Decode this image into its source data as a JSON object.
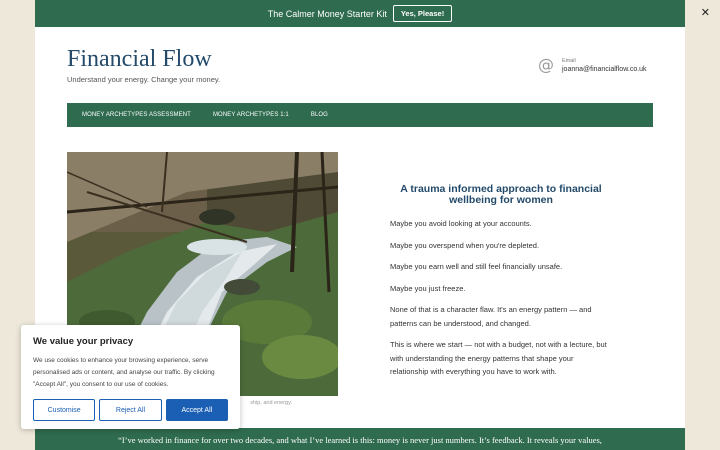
{
  "topbar": {
    "promo": "The Calmer Money Starter Kit",
    "cta": "Yes, Please!",
    "close": "✕"
  },
  "brand": {
    "title": "Financial Flow",
    "tagline": "Understand your energy. Change your money."
  },
  "contact": {
    "icon": "at-sign-icon",
    "label": "Email",
    "email": "joanna@financialflow.co.uk"
  },
  "nav": {
    "items": [
      "MONEY ARCHETYPES ASSESSMENT",
      "MONEY ARCHETYPES 1:1",
      "BLOG"
    ]
  },
  "hero": {
    "image": "stream-photo",
    "caption": "ship, and energy."
  },
  "content": {
    "heading": "A trauma informed approach to financial wellbeing for women",
    "paragraphs": [
      "Maybe you avoid looking at your accounts.",
      "Maybe you overspend when you're depleted.",
      "Maybe you earn well and still feel financially unsafe.",
      "Maybe you just freeze.",
      "None of that is a character flaw. It's an energy pattern — and patterns can be understood, and changed.",
      "This is where we start — not with a budget, not with a lecture, but with understanding the energy patterns that shape your relationship with everything you have to work with."
    ]
  },
  "quote": "“I’ve worked in finance for over two decades, and what I’ve learned is this: money is never just numbers. It’s feedback. It reveals your values,",
  "cookie": {
    "title": "We value your privacy",
    "text": "We use cookies to enhance your browsing experience, serve personalised ads or content, and analyse our traffic. By clicking \"Accept All\", you consent to our use of cookies.",
    "buttons": {
      "customise": "Customise",
      "reject": "Reject All",
      "accept": "Accept All"
    }
  },
  "colors": {
    "brand_green": "#2f6b4f",
    "title_blue": "#234a6a",
    "button_blue": "#1a5fb4",
    "background": "#ede8d9"
  }
}
